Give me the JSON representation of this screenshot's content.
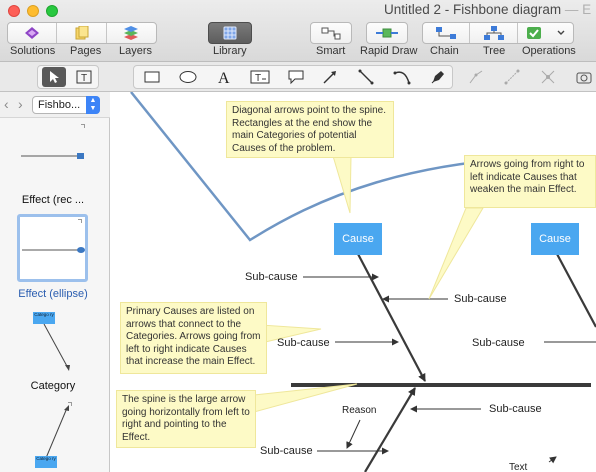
{
  "window": {
    "title": "Untitled 2 - Fishbone diagram",
    "title_suffix": "— E"
  },
  "toolbar": {
    "solutions": "Solutions",
    "pages": "Pages",
    "layers": "Layers",
    "library": "Library",
    "smart": "Smart",
    "rapid_draw": "Rapid Draw",
    "chain": "Chain",
    "tree": "Tree",
    "operations": "Operations"
  },
  "sidebar": {
    "nav_back": "‹",
    "nav_forward": "›",
    "library_select": "Fishbo...",
    "items": [
      {
        "label": "Effect (rec ..."
      },
      {
        "label": "Effect (ellipse)"
      },
      {
        "label": "Category",
        "thumb_text": "Catego ry"
      },
      {
        "label": "",
        "thumb_text": "Catego ry"
      }
    ]
  },
  "canvas": {
    "notes": {
      "diagonal": "Diagonal arrows point to the spine. Rectangles at the end show the main Categories of potential Causes of the problem.",
      "right_to_left": "Arrows going from right to left indicate Causes that weaken the main Effect.",
      "primary": "Primary Causes are listed on arrows that connect to the Categories. Arrows going from left to right indicate Causes that increase the main Effect.",
      "spine": "The spine is the large arrow going horizontally from left to right and pointing to the Effect."
    },
    "cause_boxes": [
      "Cause",
      "Cause"
    ],
    "labels": {
      "sub1": "Sub-cause",
      "sub2": "Sub-cause",
      "sub3": "Sub-cause",
      "sub4": "Sub-cause",
      "sub5": "Sub-cause",
      "sub6": "Sub-cause",
      "reason": "Reason",
      "text": "Text"
    },
    "colors": {
      "cause_fill": "#4aa7f0",
      "note_fill": "#fdfac6",
      "curve": "#6f96c4",
      "arrow": "#333333"
    }
  }
}
